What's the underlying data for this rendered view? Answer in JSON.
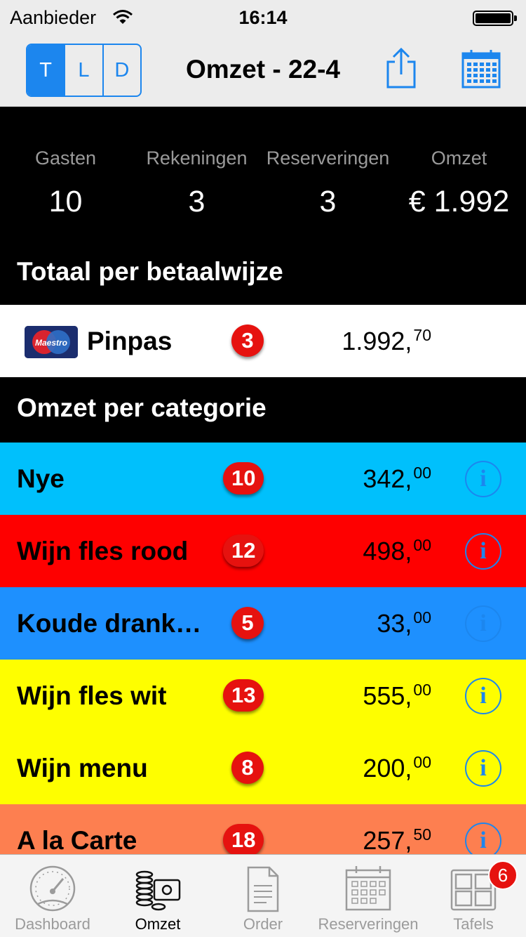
{
  "status_bar": {
    "carrier": "Aanbieder",
    "time": "16:14"
  },
  "nav": {
    "segments": [
      {
        "label": "T",
        "active": true
      },
      {
        "label": "L",
        "active": false
      },
      {
        "label": "D",
        "active": false
      }
    ],
    "title": "Omzet - 22-4",
    "share_icon": "share-icon",
    "calendar_icon": "calendar-icon"
  },
  "summary": [
    {
      "label": "Gasten",
      "value": "10"
    },
    {
      "label": "Rekeningen",
      "value": "3"
    },
    {
      "label": "Reserveringen",
      "value": "3"
    },
    {
      "label": "Omzet",
      "value": "€ 1.992"
    }
  ],
  "payment_section": {
    "title": "Totaal per betaalwijze",
    "items": [
      {
        "name": "Pinpas",
        "logo_text": "Maestro",
        "count": "3",
        "amount_int": "1.992,",
        "amount_dec": "70"
      }
    ]
  },
  "category_section": {
    "title": "Omzet per categorie",
    "items": [
      {
        "name": "Nye",
        "count": "10",
        "amount_int": "342,",
        "amount_dec": "00",
        "color": "#00c0fc"
      },
      {
        "name": "Wijn fles rood",
        "count": "12",
        "amount_int": "498,",
        "amount_dec": "00",
        "color": "#fe0000"
      },
      {
        "name": "Koude drank…",
        "count": "5",
        "amount_int": "33,",
        "amount_dec": "00",
        "color": "#1e90fe"
      },
      {
        "name": "Wijn fles wit",
        "count": "13",
        "amount_int": "555,",
        "amount_dec": "00",
        "color": "#fefe00"
      },
      {
        "name": "Wijn menu",
        "count": "8",
        "amount_int": "200,",
        "amount_dec": "00",
        "color": "#fefe00"
      },
      {
        "name": "A la Carte",
        "count": "18",
        "amount_int": "257,",
        "amount_dec": "50",
        "color": "#fd7f50"
      }
    ]
  },
  "tabbar": [
    {
      "label": "Dashboard",
      "icon": "dashboard-gauge-icon",
      "active": false
    },
    {
      "label": "Omzet",
      "icon": "coins-register-icon",
      "active": true
    },
    {
      "label": "Order",
      "icon": "document-icon",
      "active": false
    },
    {
      "label": "Reserveringen",
      "icon": "calendar-icon",
      "active": false
    },
    {
      "label": "Tafels",
      "icon": "tables-grid-icon",
      "active": false,
      "badge": "6"
    }
  ],
  "colors": {
    "accent": "#1c86ee",
    "badge": "#e6120f"
  }
}
